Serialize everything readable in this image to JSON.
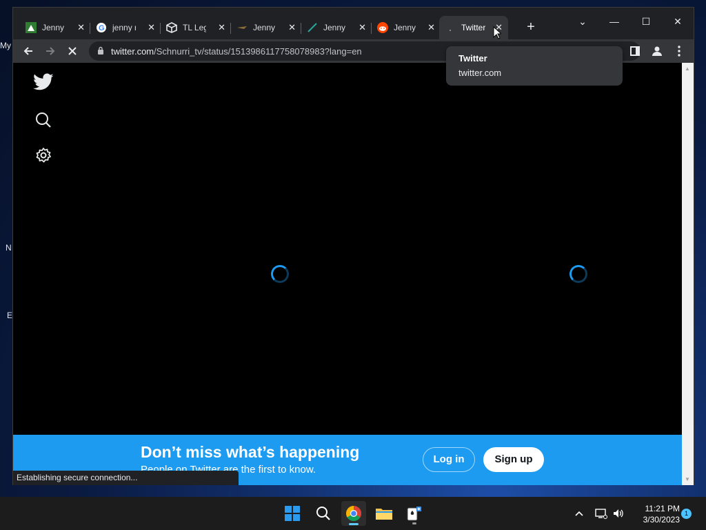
{
  "desktop": {
    "fragments": [
      "My",
      "N",
      "E"
    ]
  },
  "browser": {
    "tabs": [
      {
        "label": "Jenny M",
        "icon": "green-site-icon"
      },
      {
        "label": "jenny m",
        "icon": "google-icon"
      },
      {
        "label": "TL Legal",
        "icon": "box-icon"
      },
      {
        "label": "Jenny M",
        "icon": "dark-site-icon"
      },
      {
        "label": "Jenny M",
        "icon": "pen-icon"
      },
      {
        "label": "Jenny M",
        "icon": "reddit-icon"
      },
      {
        "label": "Twitter",
        "icon": "loading-dot-icon",
        "active": true
      }
    ],
    "close_glyph": "✕",
    "new_tab": "+",
    "window_controls": {
      "tab_search": "⌄",
      "minimize": "—",
      "maximize": "☐",
      "close": "✕"
    },
    "address": {
      "host": "twitter.com",
      "path": "/Schnurri_tv/status/1513986117758078983?lang=en"
    },
    "tooltip": {
      "title": "Twitter",
      "url": "twitter.com"
    },
    "status_text": "Establishing secure connection..."
  },
  "page": {
    "banner": {
      "heading": "Don’t miss what’s happening",
      "subheading": "People on Twitter are the first to know.",
      "login_label": "Log in",
      "signup_label": "Sign up"
    }
  },
  "taskbar": {
    "time": "11:21 PM",
    "date": "3/30/2023",
    "notifications": "1"
  },
  "colors": {
    "twitter_blue": "#1d9bf0",
    "page_bg": "#000000",
    "chrome_dark": "#202124"
  }
}
